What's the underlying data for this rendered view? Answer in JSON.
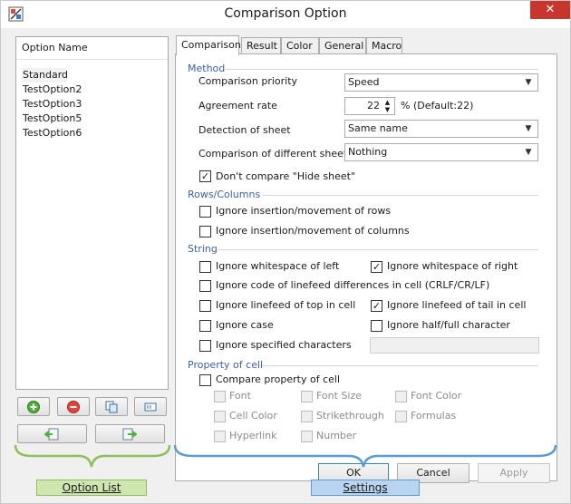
{
  "window": {
    "title": "Comparison Option",
    "close_glyph": "✕"
  },
  "option_list": {
    "header": "Option Name",
    "items": [
      "Standard",
      "TestOption2",
      "TestOption3",
      "TestOption5",
      "TestOption6"
    ],
    "selected_index": 0,
    "buttons": {
      "add_icon": "add-icon",
      "remove_icon": "remove-icon",
      "copy_icon": "copy-icon",
      "rename_icon": "rename-icon",
      "import_icon": "import-icon",
      "export_icon": "export-icon"
    }
  },
  "tabs": [
    "Comparison",
    "Result",
    "Color",
    "General",
    "Macro"
  ],
  "active_tab": "Comparison",
  "method": {
    "title": "Method",
    "priority_label": "Comparison priority",
    "priority_value": "Speed",
    "rate_label": "Agreement rate",
    "rate_value": "22",
    "rate_suffix": "% (Default:22)",
    "detection_label": "Detection of sheet",
    "detection_value": "Same name",
    "diffsheet_label": "Comparison of different sheet",
    "diffsheet_value": "Nothing",
    "hide_sheet_label": "Don't compare \"Hide sheet\"",
    "hide_sheet_checked": true
  },
  "rows_columns": {
    "title": "Rows/Columns",
    "ignore_rows_label": "Ignore insertion/movement of rows",
    "ignore_columns_label": "Ignore insertion/movement of columns"
  },
  "string": {
    "title": "String",
    "ws_left_label": "Ignore whitespace of left",
    "ws_right_label": "Ignore whitespace of right",
    "linefeed_code_label": "Ignore code of linefeed differences in cell (CRLF/CR/LF)",
    "lf_top_label": "Ignore linefeed of top in cell",
    "lf_tail_label": "Ignore linefeed of tail in cell",
    "case_label": "Ignore case",
    "halffull_label": "Ignore half/full character",
    "specified_label": "Ignore specified characters",
    "specified_value": ""
  },
  "property": {
    "title": "Property of cell",
    "compare_label": "Compare property of cell",
    "font": "Font",
    "font_size": "Font Size",
    "font_color": "Font Color",
    "cell_color": "Cell Color",
    "strikethrough": "Strikethrough",
    "formulas": "Formulas",
    "hyperlink": "Hyperlink",
    "number": "Number"
  },
  "buttons": {
    "ok": "OK",
    "cancel": "Cancel",
    "apply": "Apply"
  },
  "annotations": {
    "option_list": "Option List",
    "settings": "Settings"
  },
  "colors": {
    "section_title": "#3c5fa6",
    "callout_fill": "#cfe6b0",
    "callout_green": "#8dc05a",
    "callout_blue_fill": "#b8d4f0",
    "callout_blue": "#5b9bd5",
    "close_red": "#c7352c"
  }
}
